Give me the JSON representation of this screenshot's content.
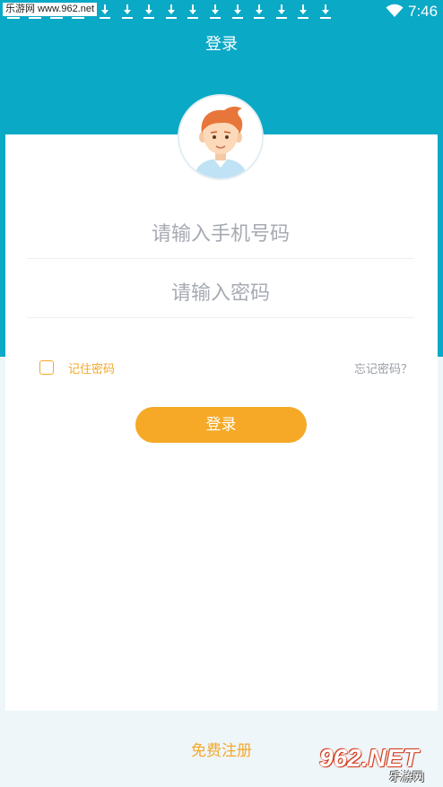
{
  "status_bar": {
    "watermark_text": "乐游网 www.962.net",
    "time": "7:46",
    "download_icon_count": 11
  },
  "header": {
    "title": "登录"
  },
  "form": {
    "phone_placeholder": "请输入手机号码",
    "password_placeholder": "请输入密码",
    "remember_label": "记住密码",
    "remember_checked": false,
    "forgot_label": "忘记密码？",
    "login_label": "登录"
  },
  "footer": {
    "register_label": "免费注册",
    "watermark_logo": "962.NET",
    "watermark_logo_cn": "乐游网"
  },
  "colors": {
    "header_bg": "#0aa9c6",
    "accent": "#f5a926",
    "page_bg": "#eef6fa"
  }
}
